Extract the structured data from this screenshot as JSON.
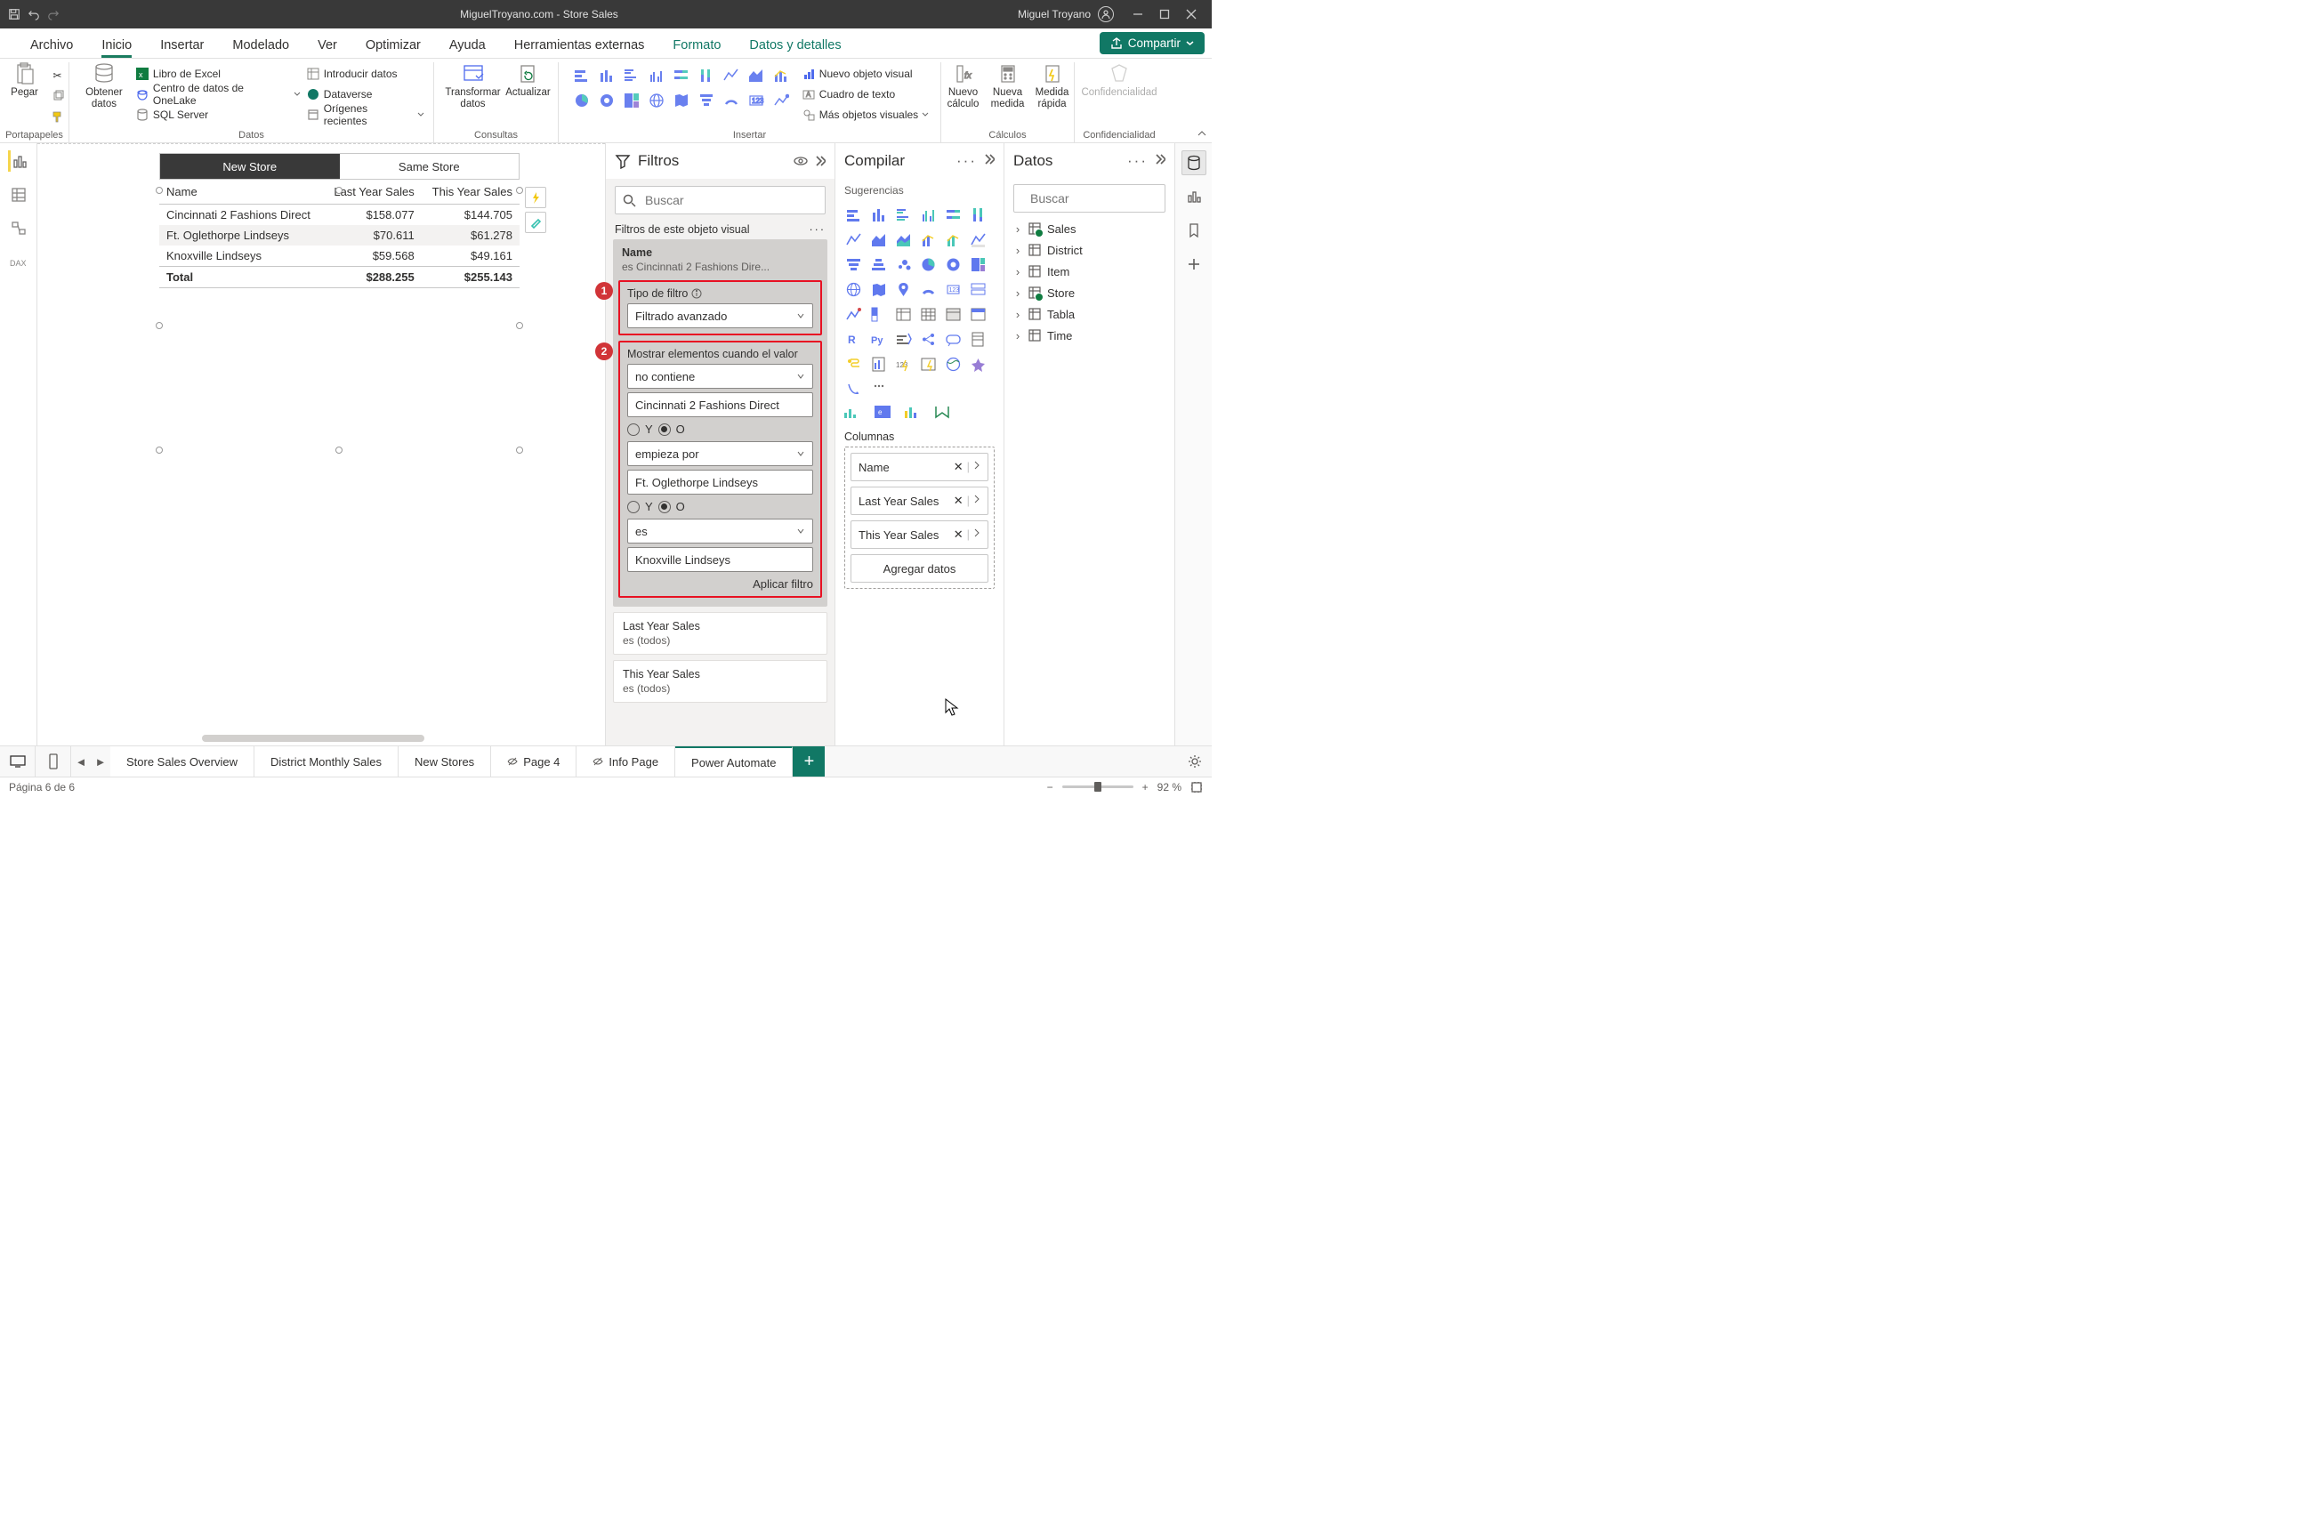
{
  "titlebar": {
    "title": "MiguelTroyano.com - Store Sales",
    "user": "Miguel Troyano"
  },
  "menu": {
    "tabs": [
      "Archivo",
      "Inicio",
      "Insertar",
      "Modelado",
      "Ver",
      "Optimizar",
      "Ayuda",
      "Herramientas externas",
      "Formato",
      "Datos y detalles"
    ],
    "active_index": 1,
    "share": "Compartir"
  },
  "ribbon": {
    "clipboard": {
      "paste": "Pegar",
      "label": "Portapapeles"
    },
    "data": {
      "get": "Obtener datos",
      "items": [
        "Libro de Excel",
        "Centro de datos de OneLake",
        "SQL Server",
        "Introducir datos",
        "Dataverse",
        "Orígenes recientes"
      ],
      "label": "Datos"
    },
    "queries": {
      "transform": "Transformar datos",
      "refresh": "Actualizar",
      "label": "Consultas"
    },
    "insert": {
      "newvisual": "Nuevo objeto visual",
      "textbox": "Cuadro de texto",
      "morevisuals": "Más objetos visuales",
      "label": "Insertar"
    },
    "calc": {
      "newcalc": "Nuevo cálculo",
      "newmeasure": "Nueva medida",
      "quickmeasure": "Medida rápida",
      "label": "Cálculos"
    },
    "sens": {
      "btn": "Confidencialidad",
      "label": "Confidencialidad"
    }
  },
  "slicer": {
    "new": "New Store",
    "same": "Same Store"
  },
  "table": {
    "headers": [
      "Name",
      "Last Year Sales",
      "This Year Sales"
    ],
    "rows": [
      {
        "name": "Cincinnati 2 Fashions Direct",
        "ly": "$158.077",
        "ty": "$144.705"
      },
      {
        "name": "Ft. Oglethorpe Lindseys",
        "ly": "$70.611",
        "ty": "$61.278"
      },
      {
        "name": "Knoxville Lindseys",
        "ly": "$59.568",
        "ty": "$49.161"
      }
    ],
    "total": {
      "name": "Total",
      "ly": "$288.255",
      "ty": "$255.143"
    }
  },
  "chart_data": {
    "type": "table",
    "columns": [
      "Name",
      "Last Year Sales",
      "This Year Sales"
    ],
    "rows": [
      [
        "Cincinnati 2 Fashions Direct",
        158077,
        144705
      ],
      [
        "Ft. Oglethorpe Lindseys",
        70611,
        61278
      ],
      [
        "Knoxville Lindseys",
        59568,
        49161
      ]
    ],
    "totals": [
      "Total",
      288255,
      255143
    ],
    "currency": "$",
    "decimal_separator": "."
  },
  "filters": {
    "title": "Filtros",
    "search_ph": "Buscar",
    "section": "Filtros de este objeto visual",
    "name_filter": {
      "header": "Name",
      "summary": "es Cincinnati 2 Fashions Dire...",
      "type_label": "Tipo de filtro",
      "type_value": "Filtrado avanzado",
      "show_label": "Mostrar elementos cuando el valor",
      "op1": "no contiene",
      "val1": "Cincinnati 2 Fashions Direct",
      "y": "Y",
      "o": "O",
      "op2": "empieza por",
      "val2": "Ft. Oglethorpe Lindseys",
      "op3": "es",
      "val3": "Knoxville Lindseys",
      "apply": "Aplicar filtro"
    },
    "other": [
      {
        "h": "Last Year Sales",
        "s": "es (todos)"
      },
      {
        "h": "This Year Sales",
        "s": "es (todos)"
      }
    ]
  },
  "compile": {
    "title": "Compilar",
    "suggestions": "Sugerencias",
    "columns_label": "Columnas",
    "fields": [
      "Name",
      "Last Year Sales",
      "This Year Sales"
    ],
    "add": "Agregar datos"
  },
  "data": {
    "title": "Datos",
    "search_ph": "Buscar",
    "tables": [
      "Sales",
      "District",
      "Item",
      "Store",
      "Tabla",
      "Time"
    ]
  },
  "pages": {
    "tabs": [
      "Store Sales Overview",
      "District Monthly Sales",
      "New Stores",
      "Page 4",
      "Info Page",
      "Power Automate"
    ],
    "active_index": 5
  },
  "status": {
    "page": "Página 6 de 6",
    "zoom": "92 %"
  }
}
